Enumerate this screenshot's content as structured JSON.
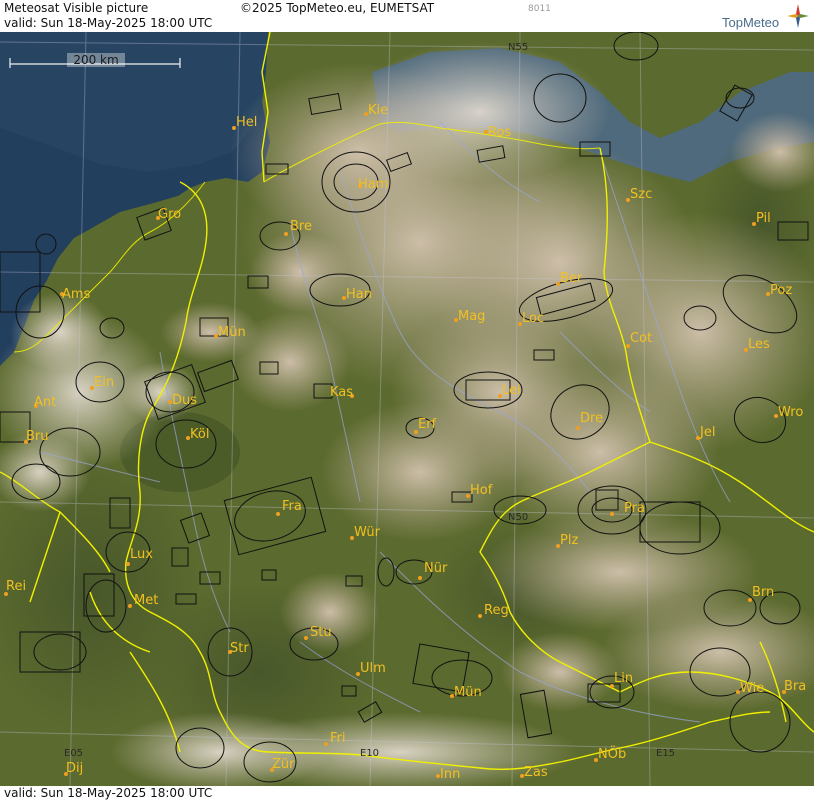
{
  "header": {
    "title": "Meteosat Visible picture",
    "copyright": "©2025 TopMeteo.eu, EUMETSAT",
    "code": "8011",
    "valid": "valid:  Sun  18-May-2025  18:00 UTC",
    "brand": "TopMeteo"
  },
  "footer": {
    "valid": "valid:  Sun  18-May-2025  18:00 UTC"
  },
  "scale": {
    "label": "200 km"
  },
  "grid_labels": [
    "N55",
    "N50",
    "E05",
    "E10",
    "E15"
  ],
  "cities": [
    {
      "name": "Kie"
    },
    {
      "name": "Hel"
    },
    {
      "name": "Ros"
    },
    {
      "name": "Ham"
    },
    {
      "name": "Szc"
    },
    {
      "name": "Gro"
    },
    {
      "name": "Bre"
    },
    {
      "name": "Pil"
    },
    {
      "name": "Ber"
    },
    {
      "name": "Ams"
    },
    {
      "name": "Han"
    },
    {
      "name": "Poz"
    },
    {
      "name": "Mün"
    },
    {
      "name": "Mag"
    },
    {
      "name": "Loc"
    },
    {
      "name": "Cot"
    },
    {
      "name": "Les"
    },
    {
      "name": "Ein"
    },
    {
      "name": "Dus"
    },
    {
      "name": "Kas"
    },
    {
      "name": "Lei"
    },
    {
      "name": "Ant"
    },
    {
      "name": "Dre"
    },
    {
      "name": "Wro"
    },
    {
      "name": "Bru"
    },
    {
      "name": "Köl"
    },
    {
      "name": "Erf"
    },
    {
      "name": "Jel"
    },
    {
      "name": "Hof"
    },
    {
      "name": "Fra"
    },
    {
      "name": "Pra"
    },
    {
      "name": "Wür"
    },
    {
      "name": "Plz"
    },
    {
      "name": "Lux"
    },
    {
      "name": "Nür"
    },
    {
      "name": "Rei"
    },
    {
      "name": "Met"
    },
    {
      "name": "Reg"
    },
    {
      "name": "Brn"
    },
    {
      "name": "Stu"
    },
    {
      "name": "Str"
    },
    {
      "name": "Ulm"
    },
    {
      "name": "Lin"
    },
    {
      "name": "Mün"
    },
    {
      "name": "Wie"
    },
    {
      "name": "Bra"
    },
    {
      "name": "Fri"
    },
    {
      "name": "Dij"
    },
    {
      "name": "Zür"
    },
    {
      "name": "NÖb"
    },
    {
      "name": "Inn"
    },
    {
      "name": "Zas"
    }
  ],
  "colors": {
    "sea": "#20405e",
    "land": "#5c6a2c",
    "cloud": "#c8b8a4",
    "border": "#f0f000",
    "city_dot": "#f0a020",
    "city_label": "#f2c020",
    "grid": "#c8c8e0"
  }
}
